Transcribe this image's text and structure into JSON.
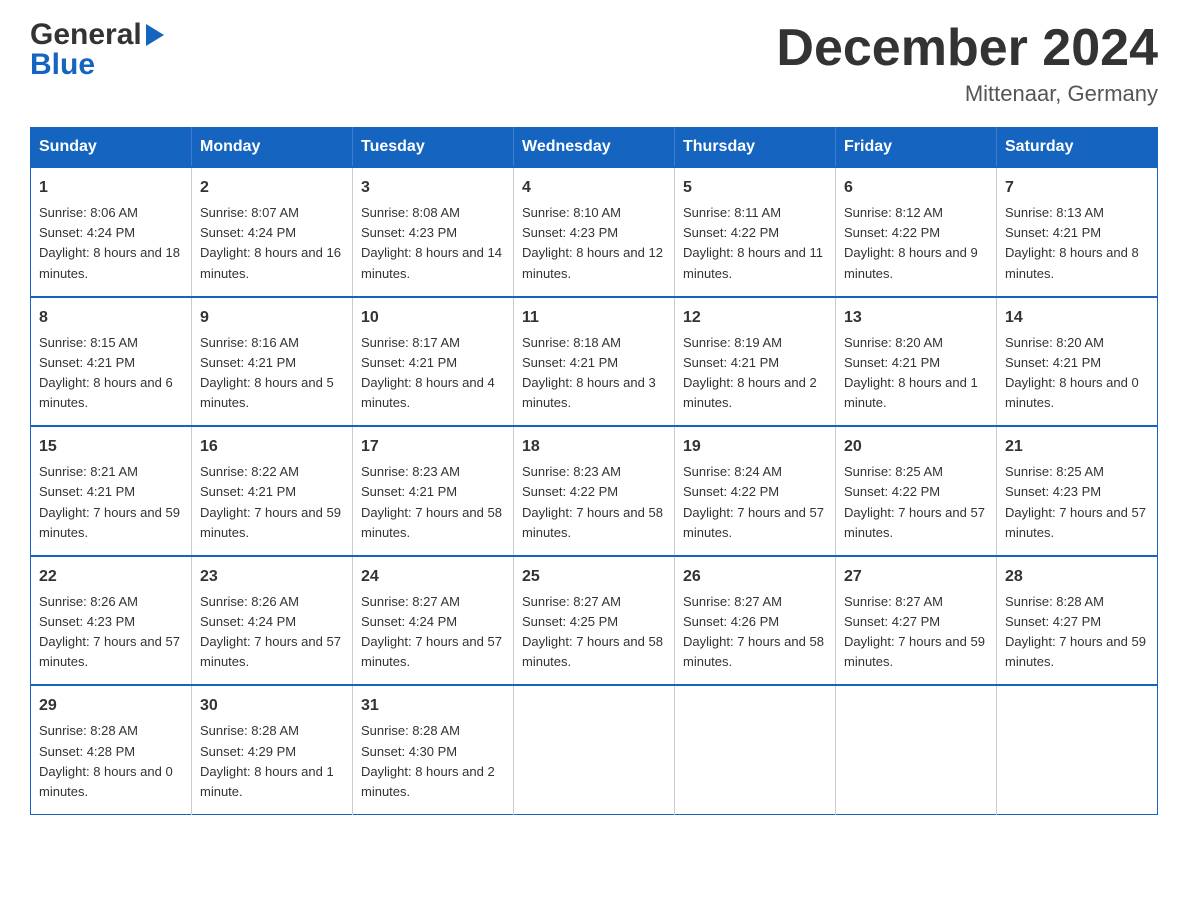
{
  "header": {
    "logo_general": "General",
    "logo_blue": "Blue",
    "month_title": "December 2024",
    "location": "Mittenaar, Germany"
  },
  "calendar": {
    "weekdays": [
      "Sunday",
      "Monday",
      "Tuesday",
      "Wednesday",
      "Thursday",
      "Friday",
      "Saturday"
    ],
    "weeks": [
      [
        {
          "day": "1",
          "sunrise": "8:06 AM",
          "sunset": "4:24 PM",
          "daylight": "8 hours and 18 minutes."
        },
        {
          "day": "2",
          "sunrise": "8:07 AM",
          "sunset": "4:24 PM",
          "daylight": "8 hours and 16 minutes."
        },
        {
          "day": "3",
          "sunrise": "8:08 AM",
          "sunset": "4:23 PM",
          "daylight": "8 hours and 14 minutes."
        },
        {
          "day": "4",
          "sunrise": "8:10 AM",
          "sunset": "4:23 PM",
          "daylight": "8 hours and 12 minutes."
        },
        {
          "day": "5",
          "sunrise": "8:11 AM",
          "sunset": "4:22 PM",
          "daylight": "8 hours and 11 minutes."
        },
        {
          "day": "6",
          "sunrise": "8:12 AM",
          "sunset": "4:22 PM",
          "daylight": "8 hours and 9 minutes."
        },
        {
          "day": "7",
          "sunrise": "8:13 AM",
          "sunset": "4:21 PM",
          "daylight": "8 hours and 8 minutes."
        }
      ],
      [
        {
          "day": "8",
          "sunrise": "8:15 AM",
          "sunset": "4:21 PM",
          "daylight": "8 hours and 6 minutes."
        },
        {
          "day": "9",
          "sunrise": "8:16 AM",
          "sunset": "4:21 PM",
          "daylight": "8 hours and 5 minutes."
        },
        {
          "day": "10",
          "sunrise": "8:17 AM",
          "sunset": "4:21 PM",
          "daylight": "8 hours and 4 minutes."
        },
        {
          "day": "11",
          "sunrise": "8:18 AM",
          "sunset": "4:21 PM",
          "daylight": "8 hours and 3 minutes."
        },
        {
          "day": "12",
          "sunrise": "8:19 AM",
          "sunset": "4:21 PM",
          "daylight": "8 hours and 2 minutes."
        },
        {
          "day": "13",
          "sunrise": "8:20 AM",
          "sunset": "4:21 PM",
          "daylight": "8 hours and 1 minute."
        },
        {
          "day": "14",
          "sunrise": "8:20 AM",
          "sunset": "4:21 PM",
          "daylight": "8 hours and 0 minutes."
        }
      ],
      [
        {
          "day": "15",
          "sunrise": "8:21 AM",
          "sunset": "4:21 PM",
          "daylight": "7 hours and 59 minutes."
        },
        {
          "day": "16",
          "sunrise": "8:22 AM",
          "sunset": "4:21 PM",
          "daylight": "7 hours and 59 minutes."
        },
        {
          "day": "17",
          "sunrise": "8:23 AM",
          "sunset": "4:21 PM",
          "daylight": "7 hours and 58 minutes."
        },
        {
          "day": "18",
          "sunrise": "8:23 AM",
          "sunset": "4:22 PM",
          "daylight": "7 hours and 58 minutes."
        },
        {
          "day": "19",
          "sunrise": "8:24 AM",
          "sunset": "4:22 PM",
          "daylight": "7 hours and 57 minutes."
        },
        {
          "day": "20",
          "sunrise": "8:25 AM",
          "sunset": "4:22 PM",
          "daylight": "7 hours and 57 minutes."
        },
        {
          "day": "21",
          "sunrise": "8:25 AM",
          "sunset": "4:23 PM",
          "daylight": "7 hours and 57 minutes."
        }
      ],
      [
        {
          "day": "22",
          "sunrise": "8:26 AM",
          "sunset": "4:23 PM",
          "daylight": "7 hours and 57 minutes."
        },
        {
          "day": "23",
          "sunrise": "8:26 AM",
          "sunset": "4:24 PM",
          "daylight": "7 hours and 57 minutes."
        },
        {
          "day": "24",
          "sunrise": "8:27 AM",
          "sunset": "4:24 PM",
          "daylight": "7 hours and 57 minutes."
        },
        {
          "day": "25",
          "sunrise": "8:27 AM",
          "sunset": "4:25 PM",
          "daylight": "7 hours and 58 minutes."
        },
        {
          "day": "26",
          "sunrise": "8:27 AM",
          "sunset": "4:26 PM",
          "daylight": "7 hours and 58 minutes."
        },
        {
          "day": "27",
          "sunrise": "8:27 AM",
          "sunset": "4:27 PM",
          "daylight": "7 hours and 59 minutes."
        },
        {
          "day": "28",
          "sunrise": "8:28 AM",
          "sunset": "4:27 PM",
          "daylight": "7 hours and 59 minutes."
        }
      ],
      [
        {
          "day": "29",
          "sunrise": "8:28 AM",
          "sunset": "4:28 PM",
          "daylight": "8 hours and 0 minutes."
        },
        {
          "day": "30",
          "sunrise": "8:28 AM",
          "sunset": "4:29 PM",
          "daylight": "8 hours and 1 minute."
        },
        {
          "day": "31",
          "sunrise": "8:28 AM",
          "sunset": "4:30 PM",
          "daylight": "8 hours and 2 minutes."
        },
        null,
        null,
        null,
        null
      ]
    ]
  }
}
